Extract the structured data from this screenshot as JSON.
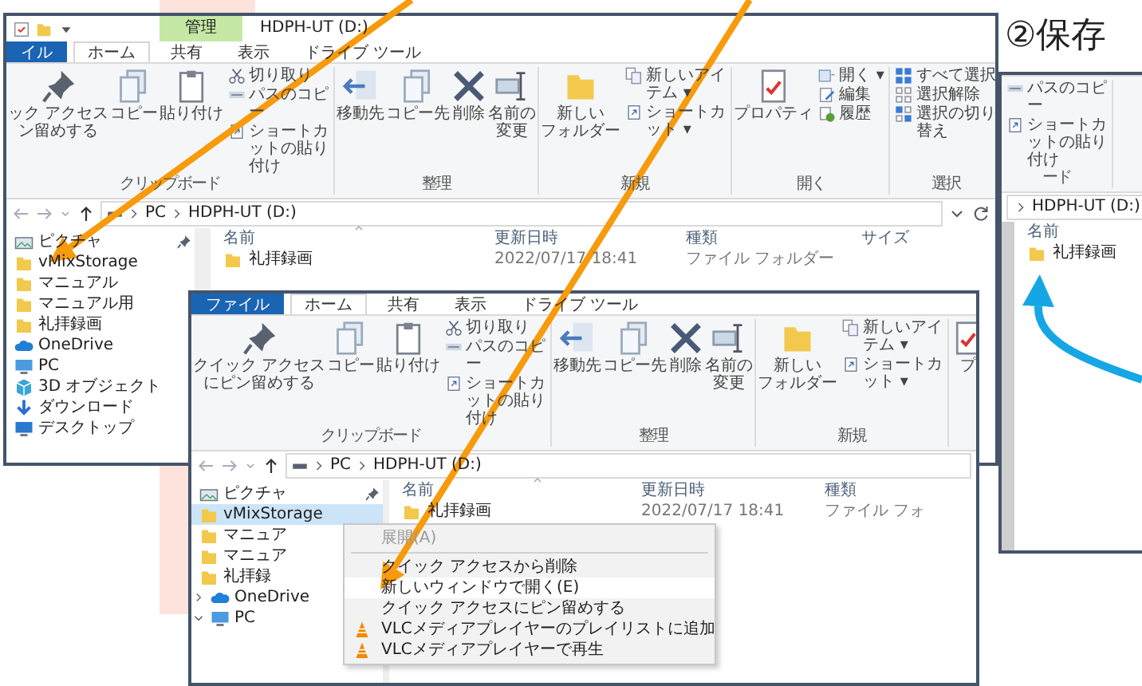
{
  "heading": "②保存",
  "windows": [
    {
      "kind": "full",
      "context_tab": "管理",
      "title": "HDPH-UT (D:)",
      "tabs": [
        {
          "label": "イル",
          "kind": "file",
          "selected": false
        },
        {
          "label": "ホーム",
          "kind": "tab",
          "selected": true
        },
        {
          "label": "共有",
          "kind": "tab",
          "selected": false
        },
        {
          "label": "表示",
          "kind": "tab",
          "selected": false
        },
        {
          "label": "ドライブ ツール",
          "kind": "tab",
          "selected": false
        }
      ],
      "ribbon": [
        {
          "label": "クリップボード",
          "items": [
            {
              "kind": "pin",
              "lines": [
                "ック アクセス",
                "ン留めする"
              ]
            },
            {
              "kind": "copy",
              "label": "コピー"
            },
            {
              "kind": "paste",
              "label": "貼り付け"
            },
            {
              "kind": "cut",
              "label": "切り取り"
            },
            {
              "kind": "copypath",
              "label": "パスのコピー"
            },
            {
              "kind": "shortcut",
              "label": "ショートカットの貼り付け"
            }
          ]
        },
        {
          "label": "整理",
          "items": [
            {
              "kind": "move",
              "label": "移動先"
            },
            {
              "kind": "copyto",
              "label": "コピー先"
            },
            {
              "kind": "delete",
              "label": "削除"
            },
            {
              "kind": "rename",
              "lines": [
                "名前の",
                "変更"
              ]
            }
          ]
        },
        {
          "label": "新規",
          "items": [
            {
              "kind": "newfolder",
              "lines": [
                "新しい",
                "フォルダー"
              ]
            },
            {
              "kind": "newitem",
              "label": "新しいアイテム ▾"
            },
            {
              "kind": "easyaccess",
              "label": "ショートカット ▾"
            }
          ]
        },
        {
          "label": "開く",
          "items": [
            {
              "kind": "properties",
              "label": "プロパティ"
            },
            {
              "kind": "open",
              "label": "開く ▾"
            },
            {
              "kind": "edit",
              "label": "編集"
            },
            {
              "kind": "history",
              "label": "履歴"
            }
          ]
        },
        {
          "label": "選択",
          "items": [
            {
              "kind": "selectall",
              "label": "すべて選択"
            },
            {
              "kind": "selectnone",
              "label": "選択解除"
            },
            {
              "kind": "invert",
              "label": "選択の切り替え"
            }
          ]
        }
      ],
      "address": [
        "PC",
        "HDPH-UT (D:)"
      ],
      "nav_pane": [
        {
          "label": "ピクチャ",
          "kind": "pictures",
          "pinned": true,
          "selected": false
        },
        {
          "label": "vMixStorage",
          "kind": "folder",
          "pinned": false,
          "selected": false
        },
        {
          "label": "マニュアル",
          "kind": "folder",
          "pinned": false,
          "selected": false
        },
        {
          "label": "マニュアル用",
          "kind": "folder",
          "pinned": false,
          "selected": false
        },
        {
          "label": "礼拝録画",
          "kind": "folder",
          "pinned": false,
          "selected": false
        },
        {
          "label": "OneDrive",
          "kind": "cloud",
          "pinned": false,
          "selected": false
        },
        {
          "label": "PC",
          "kind": "pc",
          "pinned": false,
          "selected": false
        },
        {
          "label": "3D オブジェクト",
          "kind": "cube",
          "pinned": false,
          "selected": false
        },
        {
          "label": "ダウンロード",
          "kind": "download",
          "pinned": false,
          "selected": false
        },
        {
          "label": "デスクトップ",
          "kind": "desktop",
          "pinned": false,
          "selected": false
        }
      ],
      "columns": [
        "名前",
        "更新日時",
        "種類",
        "サイズ"
      ],
      "rows": [
        {
          "name": "礼拝録画",
          "modified": "2022/07/17 18:41",
          "type": "ファイル フォルダー"
        }
      ]
    },
    {
      "kind": "full",
      "tabs": [
        {
          "label": "ファイル",
          "kind": "file",
          "selected": false
        },
        {
          "label": "ホーム",
          "kind": "tab",
          "selected": true
        },
        {
          "label": "共有",
          "kind": "tab",
          "selected": false
        },
        {
          "label": "表示",
          "kind": "tab",
          "selected": false
        },
        {
          "label": "ドライブ ツール",
          "kind": "tab",
          "selected": false
        }
      ],
      "ribbon": [
        {
          "label": "クリップボード",
          "items": [
            {
              "kind": "pin",
              "lines": [
                "クイック アクセス",
                "にピン留めする"
              ]
            },
            {
              "kind": "copy",
              "label": "コピー"
            },
            {
              "kind": "paste",
              "label": "貼り付け"
            },
            {
              "kind": "cut",
              "label": "切り取り"
            },
            {
              "kind": "copypath",
              "label": "パスのコピー"
            },
            {
              "kind": "shortcut",
              "label": "ショートカットの貼り付け"
            }
          ]
        },
        {
          "label": "整理",
          "items": [
            {
              "kind": "move",
              "label": "移動先"
            },
            {
              "kind": "copyto",
              "label": "コピー先"
            },
            {
              "kind": "delete",
              "label": "削除"
            },
            {
              "kind": "rename",
              "lines": [
                "名前の",
                "変更"
              ]
            }
          ]
        },
        {
          "label": "新規",
          "items": [
            {
              "kind": "newfolder",
              "lines": [
                "新しい",
                "フォルダー"
              ]
            },
            {
              "kind": "newitem",
              "label": "新しいアイテム ▾"
            },
            {
              "kind": "easyaccess",
              "label": "ショートカット ▾"
            }
          ]
        },
        {
          "items": [
            {
              "kind": "properties",
              "label": "プ"
            }
          ]
        }
      ],
      "address": [
        "PC",
        "HDPH-UT (D:)"
      ],
      "nav_pane": [
        {
          "label": "ピクチャ",
          "kind": "pictures",
          "pinned": true,
          "selected": false
        },
        {
          "label": "vMixStorage",
          "kind": "folder",
          "pinned": false,
          "selected": true
        },
        {
          "label": "マニュア",
          "kind": "folder",
          "pinned": false,
          "selected": false
        },
        {
          "label": "マニュア",
          "kind": "folder",
          "pinned": false,
          "selected": false
        },
        {
          "label": "礼拝録",
          "kind": "folder",
          "pinned": false,
          "selected": false
        },
        {
          "label": "OneDrive",
          "kind": "cloud",
          "pinned": false,
          "selected": false,
          "expanded": false
        },
        {
          "label": "PC",
          "kind": "pc",
          "pinned": false,
          "selected": false,
          "expanded": true
        }
      ],
      "columns": [
        "名前",
        "更新日時",
        "種類"
      ],
      "rows": [
        {
          "name": "礼拝録画",
          "modified": "2022/07/17 18:41",
          "type": "ファイル フォ"
        }
      ]
    },
    {
      "kind": "fragment",
      "ribbon": [
        {
          "label": "ード",
          "items": [
            {
              "kind": "copypath",
              "label": "パスのコピー"
            },
            {
              "kind": "shortcut",
              "label": "ショートカットの貼り付け"
            }
          ]
        }
      ],
      "address": [
        "HDPH-UT (D:)"
      ],
      "columns": [
        "名前"
      ],
      "rows": [
        {
          "name": "礼拝録画"
        }
      ]
    }
  ],
  "context_menu": {
    "groups": [
      {
        "items": [
          {
            "label": "展開(A)",
            "kind": "plain",
            "disabled": true,
            "selected": false
          }
        ]
      },
      {
        "items": [
          {
            "label": "クイック アクセスから削除",
            "kind": "plain",
            "disabled": false,
            "selected": false
          },
          {
            "label": "新しいウィンドウで開く(E)",
            "kind": "plain",
            "disabled": false,
            "selected": true
          },
          {
            "label": "クイック アクセスにピン留めする",
            "kind": "plain",
            "disabled": false,
            "selected": false
          },
          {
            "label": "VLCメディアプレイヤーのプレイリストに追加",
            "kind": "vlc",
            "disabled": false,
            "selected": false
          },
          {
            "label": "VLCメディアプレイヤーで再生",
            "kind": "vlc",
            "disabled": false,
            "selected": false
          }
        ]
      }
    ]
  }
}
